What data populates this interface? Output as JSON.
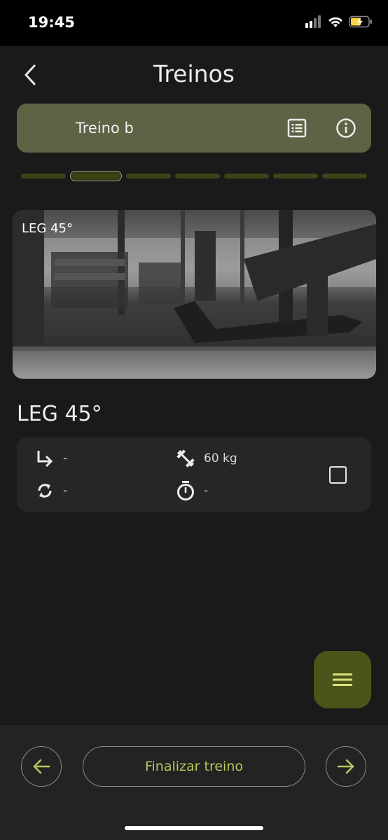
{
  "status_bar": {
    "time": "19:45"
  },
  "header": {
    "title": "Treinos"
  },
  "workout": {
    "name": "Treino b",
    "total_segments": 7,
    "current_segment": 2
  },
  "exercise": {
    "image_caption": "LEG 45°",
    "title": "LEG 45°",
    "sets": "-",
    "weight": "60 kg",
    "reps": "-",
    "rest": "-"
  },
  "bottom": {
    "finish_label": "Finalizar treino"
  },
  "colors": {
    "accent": "#b8c65e",
    "card": "#5f6345",
    "fab": "#4c5419",
    "progress": "#3b4416",
    "background": "#1a1a1a"
  }
}
